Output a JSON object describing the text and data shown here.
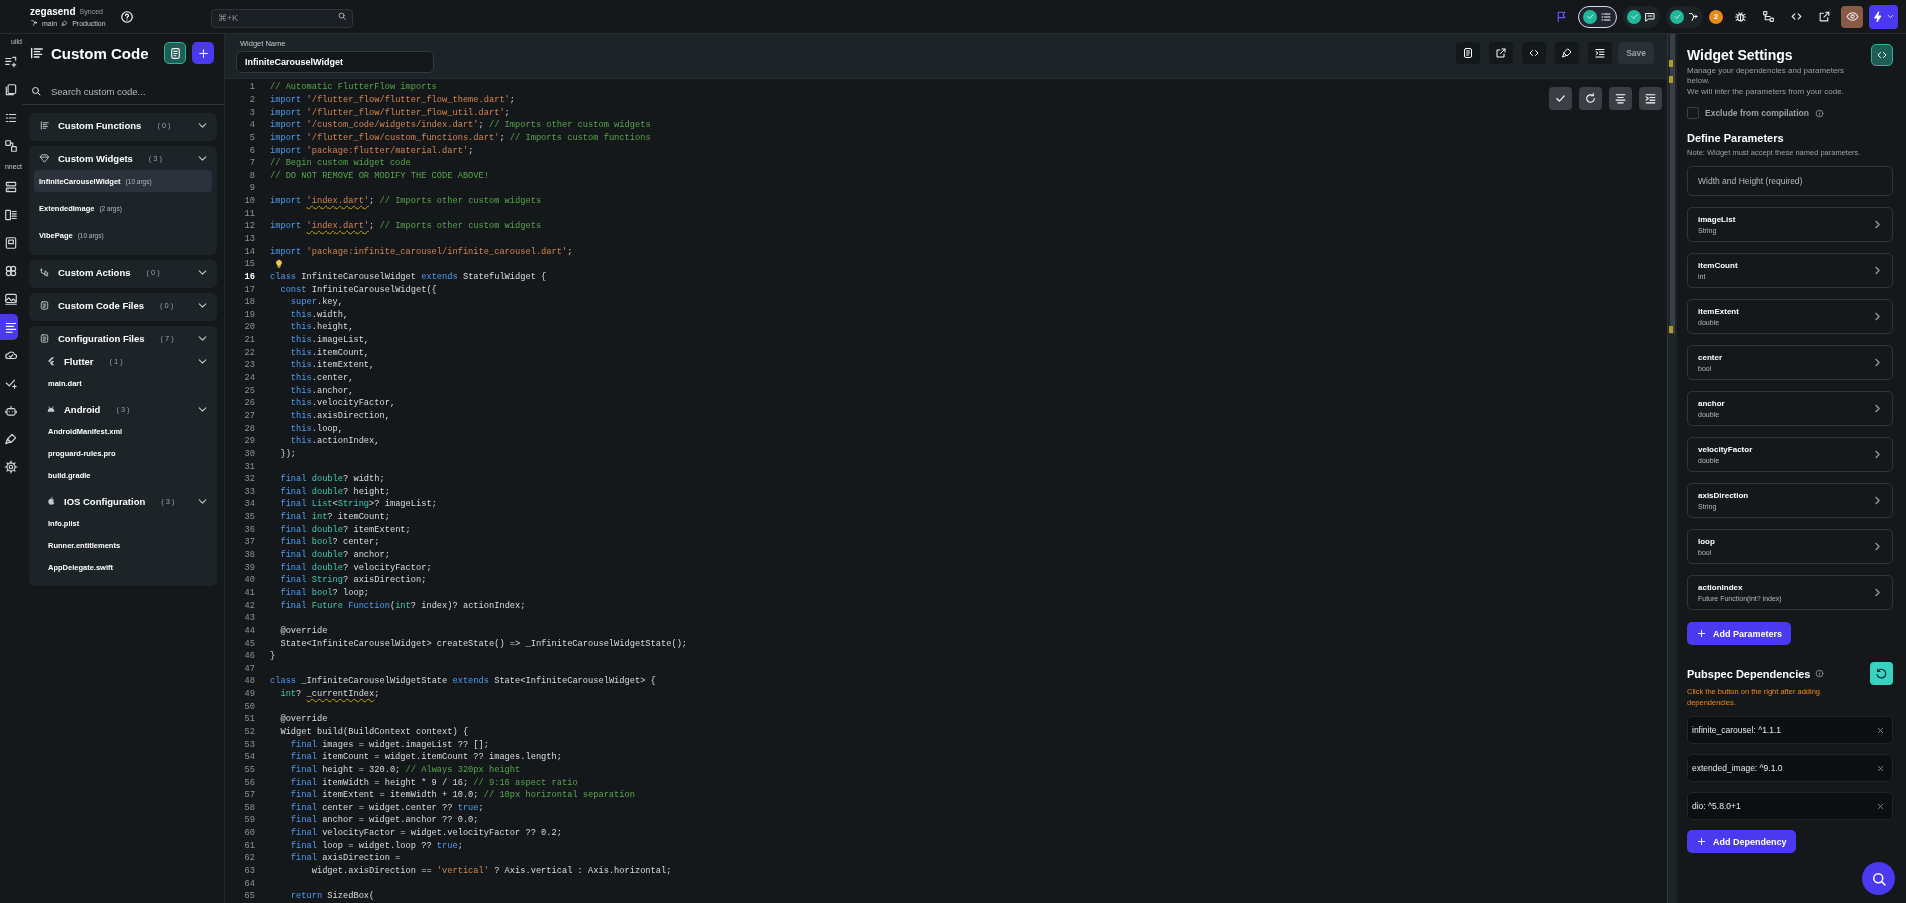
{
  "top_bar": {
    "project": "zegasend",
    "sync_status": "Synced",
    "branch": "main",
    "environment": "Production",
    "search": {
      "placeholder": "⌘+K"
    },
    "badge_count": "2",
    "preview_selected": true
  },
  "rail": {
    "groups": [
      {
        "label": "uild",
        "items": [
          {
            "selected": false
          },
          {
            "selected": false
          },
          {
            "selected": false
          },
          {
            "selected": false
          }
        ]
      },
      {
        "label": "nnect",
        "items": [
          {
            "selected": false
          },
          {
            "selected": false
          },
          {
            "selected": false
          },
          {
            "selected": false
          },
          {
            "selected": false
          },
          {
            "selected": true
          },
          {
            "selected": false
          },
          {
            "selected": false
          },
          {
            "selected": false
          },
          {
            "selected": false
          },
          {
            "selected": false
          }
        ]
      }
    ]
  },
  "sidebar": {
    "title": "Custom Code",
    "search": {
      "placeholder": "Search custom code..."
    },
    "sections": [
      {
        "title": "Custom Functions",
        "count": "(0)"
      },
      {
        "title": "Custom Widgets",
        "count": "(3)",
        "items": [
          {
            "name": "InfiniteCarouselWidget",
            "args": "(10 args)",
            "selected": true
          },
          {
            "name": "ExtendedImage",
            "args": "(2 args)",
            "selected": false
          },
          {
            "name": "VibePage",
            "args": "(10 args)",
            "selected": false
          }
        ]
      },
      {
        "title": "Custom Actions",
        "count": "(0)"
      },
      {
        "title": "Custom Code Files",
        "count": "(0)"
      },
      {
        "title": "Configuration Files",
        "count": "(7)",
        "groups": [
          {
            "title": "Flutter",
            "count": "(1)",
            "files": [
              "main.dart"
            ]
          },
          {
            "title": "Android",
            "count": "(3)",
            "files": [
              "AndroidManifest.xml",
              "proguard-rules.pro",
              "build.gradle"
            ]
          },
          {
            "title": "IOS Configuration",
            "count": "(3)",
            "files": [
              "Info.plist",
              "Runner.entitlements",
              "AppDelegate.swift"
            ]
          }
        ]
      }
    ]
  },
  "editor": {
    "widget_name": {
      "label": "Widget Name",
      "value": "InfiniteCarouselWidget"
    },
    "save_label": "Save",
    "lines": [
      {
        "number": "1",
        "current": false,
        "kind": "code",
        "tokens": [
          {
            "kind": "cmt",
            "text": "// Automatic FlutterFlow imports"
          }
        ]
      },
      {
        "number": "2",
        "current": false,
        "kind": "code",
        "tokens": [
          {
            "kind": "kw",
            "text": "import "
          },
          {
            "kind": "str",
            "text": "'/flutter_flow/flutter_flow_theme.dart'"
          },
          {
            "kind": "plain",
            "text": ";"
          }
        ]
      },
      {
        "number": "3",
        "current": false,
        "kind": "code",
        "tokens": [
          {
            "kind": "kw",
            "text": "import "
          },
          {
            "kind": "str",
            "text": "'/flutter_flow/flutter_flow_util.dart'"
          },
          {
            "kind": "plain",
            "text": ";"
          }
        ]
      },
      {
        "number": "4",
        "current": false,
        "kind": "code",
        "tokens": [
          {
            "kind": "kw",
            "text": "import "
          },
          {
            "kind": "str",
            "text": "'/custom_code/widgets/index.dart'"
          },
          {
            "kind": "plain",
            "text": "; "
          },
          {
            "kind": "cmt",
            "text": "// Imports other custom widgets"
          }
        ]
      },
      {
        "number": "5",
        "current": false,
        "kind": "code",
        "tokens": [
          {
            "kind": "kw",
            "text": "import "
          },
          {
            "kind": "str",
            "text": "'/flutter_flow/custom_functions.dart'"
          },
          {
            "kind": "plain",
            "text": "; "
          },
          {
            "kind": "cmt",
            "text": "// Imports custom functions"
          }
        ]
      },
      {
        "number": "6",
        "current": false,
        "kind": "code",
        "tokens": [
          {
            "kind": "kw",
            "text": "import "
          },
          {
            "kind": "str",
            "text": "'package:flutter/material.dart'"
          },
          {
            "kind": "plain",
            "text": ";"
          }
        ]
      },
      {
        "number": "7",
        "current": false,
        "kind": "code",
        "tokens": [
          {
            "kind": "cmt",
            "text": "// Begin custom widget code"
          }
        ]
      },
      {
        "number": "8",
        "current": false,
        "kind": "code",
        "tokens": [
          {
            "kind": "cmt",
            "text": "// DO NOT REMOVE OR MODIFY THE CODE ABOVE!"
          }
        ]
      },
      {
        "number": "9",
        "current": false,
        "kind": "code"
      },
      {
        "number": "10",
        "current": false,
        "kind": "code",
        "tokens": [
          {
            "kind": "kw",
            "text": "import "
          },
          {
            "kind": "warn_str",
            "text": "'index.dart'"
          },
          {
            "kind": "plain",
            "text": "; "
          },
          {
            "kind": "cmt",
            "text": "// Imports other custom widgets"
          }
        ]
      },
      {
        "number": "11",
        "current": false,
        "kind": "code"
      },
      {
        "number": "12",
        "current": false,
        "kind": "code",
        "tokens": [
          {
            "kind": "kw",
            "text": "import "
          },
          {
            "kind": "warn_str",
            "text": "'index.dart'"
          },
          {
            "kind": "plain",
            "text": "; "
          },
          {
            "kind": "cmt",
            "text": "// Imports other custom widgets"
          }
        ]
      },
      {
        "number": "13",
        "current": false,
        "kind": "code"
      },
      {
        "number": "14",
        "current": false,
        "kind": "code",
        "tokens": [
          {
            "kind": "kw",
            "text": "import "
          },
          {
            "kind": "str",
            "text": "'package:infinite_carousel/infinite_carousel.dart'"
          },
          {
            "kind": "plain",
            "text": ";"
          }
        ]
      },
      {
        "number": "15",
        "current": false,
        "kind": "hint"
      },
      {
        "number": "16",
        "current": true,
        "kind": "code",
        "tokens": [
          {
            "kind": "kw",
            "text": "class"
          },
          {
            "kind": "plain",
            "text": " InfiniteCarouselWidget "
          },
          {
            "kind": "kw",
            "text": "extends"
          },
          {
            "kind": "plain",
            "text": " StatefulWidget {"
          }
        ]
      },
      {
        "number": "17",
        "current": false,
        "kind": "code",
        "tokens": [
          {
            "kind": "kw",
            "text": "  const"
          },
          {
            "kind": "plain",
            "text": " InfiniteCarouselWidget({"
          }
        ]
      },
      {
        "number": "18",
        "current": false,
        "kind": "code",
        "tokens": [
          {
            "kind": "kw",
            "text": "    super"
          },
          {
            "kind": "plain",
            "text": ".key,"
          }
        ]
      },
      {
        "number": "19",
        "current": false,
        "kind": "code",
        "tokens": [
          {
            "kind": "kw",
            "text": "    this"
          },
          {
            "kind": "plain",
            "text": ".width,"
          }
        ]
      },
      {
        "number": "20",
        "current": false,
        "kind": "code",
        "tokens": [
          {
            "kind": "kw",
            "text": "    this"
          },
          {
            "kind": "plain",
            "text": ".height,"
          }
        ]
      },
      {
        "number": "21",
        "current": false,
        "kind": "code",
        "tokens": [
          {
            "kind": "kw",
            "text": "    this"
          },
          {
            "kind": "plain",
            "text": ".imageList,"
          }
        ]
      },
      {
        "number": "22",
        "current": false,
        "kind": "code",
        "tokens": [
          {
            "kind": "kw",
            "text": "    this"
          },
          {
            "kind": "plain",
            "text": ".itemCount,"
          }
        ]
      },
      {
        "number": "23",
        "current": false,
        "kind": "code",
        "tokens": [
          {
            "kind": "kw",
            "text": "    this"
          },
          {
            "kind": "plain",
            "text": ".itemExtent,"
          }
        ]
      },
      {
        "number": "24",
        "current": false,
        "kind": "code",
        "tokens": [
          {
            "kind": "kw",
            "text": "    this"
          },
          {
            "kind": "plain",
            "text": ".center,"
          }
        ]
      },
      {
        "number": "25",
        "current": false,
        "kind": "code",
        "tokens": [
          {
            "kind": "kw",
            "text": "    this"
          },
          {
            "kind": "plain",
            "text": ".anchor,"
          }
        ]
      },
      {
        "number": "26",
        "current": false,
        "kind": "code",
        "tokens": [
          {
            "kind": "kw",
            "text": "    this"
          },
          {
            "kind": "plain",
            "text": ".velocityFactor,"
          }
        ]
      },
      {
        "number": "27",
        "current": false,
        "kind": "code",
        "tokens": [
          {
            "kind": "kw",
            "text": "    this"
          },
          {
            "kind": "plain",
            "text": ".axisDirection,"
          }
        ]
      },
      {
        "number": "28",
        "current": false,
        "kind": "code",
        "tokens": [
          {
            "kind": "kw",
            "text": "    this"
          },
          {
            "kind": "plain",
            "text": ".loop,"
          }
        ]
      },
      {
        "number": "29",
        "current": false,
        "kind": "code",
        "tokens": [
          {
            "kind": "kw",
            "text": "    this"
          },
          {
            "kind": "plain",
            "text": ".actionIndex,"
          }
        ]
      },
      {
        "number": "30",
        "current": false,
        "kind": "code",
        "tokens": [
          {
            "kind": "plain",
            "text": "  });"
          }
        ]
      },
      {
        "number": "31",
        "current": false,
        "kind": "code"
      },
      {
        "number": "32",
        "current": false,
        "kind": "code",
        "tokens": [
          {
            "kind": "kw",
            "text": "  final "
          },
          {
            "kind": "type",
            "text": "double"
          },
          {
            "kind": "plain",
            "text": "? width;"
          }
        ]
      },
      {
        "number": "33",
        "current": false,
        "kind": "code",
        "tokens": [
          {
            "kind": "kw",
            "text": "  final "
          },
          {
            "kind": "type",
            "text": "double"
          },
          {
            "kind": "plain",
            "text": "? height;"
          }
        ]
      },
      {
        "number": "34",
        "current": false,
        "kind": "code",
        "tokens": [
          {
            "kind": "kw",
            "text": "  final "
          },
          {
            "kind": "type",
            "text": "List"
          },
          {
            "kind": "plain",
            "text": "<"
          },
          {
            "kind": "type",
            "text": "String"
          },
          {
            "kind": "plain",
            "text": ">? imageList;"
          }
        ]
      },
      {
        "number": "35",
        "current": false,
        "kind": "code",
        "tokens": [
          {
            "kind": "kw",
            "text": "  final "
          },
          {
            "kind": "type",
            "text": "int"
          },
          {
            "kind": "plain",
            "text": "? itemCount;"
          }
        ]
      },
      {
        "number": "36",
        "current": false,
        "kind": "code",
        "tokens": [
          {
            "kind": "kw",
            "text": "  final "
          },
          {
            "kind": "type",
            "text": "double"
          },
          {
            "kind": "plain",
            "text": "? itemExtent;"
          }
        ]
      },
      {
        "number": "37",
        "current": false,
        "kind": "code",
        "tokens": [
          {
            "kind": "kw",
            "text": "  final "
          },
          {
            "kind": "type",
            "text": "bool"
          },
          {
            "kind": "plain",
            "text": "? center;"
          }
        ]
      },
      {
        "number": "38",
        "current": false,
        "kind": "code",
        "tokens": [
          {
            "kind": "kw",
            "text": "  final "
          },
          {
            "kind": "type",
            "text": "double"
          },
          {
            "kind": "plain",
            "text": "? anchor;"
          }
        ]
      },
      {
        "number": "39",
        "current": false,
        "kind": "code",
        "tokens": [
          {
            "kind": "kw",
            "text": "  final "
          },
          {
            "kind": "type",
            "text": "double"
          },
          {
            "kind": "plain",
            "text": "? velocityFactor;"
          }
        ]
      },
      {
        "number": "40",
        "current": false,
        "kind": "code",
        "tokens": [
          {
            "kind": "kw",
            "text": "  final "
          },
          {
            "kind": "type",
            "text": "String"
          },
          {
            "kind": "plain",
            "text": "? axisDirection;"
          }
        ]
      },
      {
        "number": "41",
        "current": false,
        "kind": "code",
        "tokens": [
          {
            "kind": "kw",
            "text": "  final "
          },
          {
            "kind": "type",
            "text": "bool"
          },
          {
            "kind": "plain",
            "text": "? loop;"
          }
        ]
      },
      {
        "number": "42",
        "current": false,
        "kind": "code",
        "tokens": [
          {
            "kind": "kw",
            "text": "  final "
          },
          {
            "kind": "type",
            "text": "Future "
          },
          {
            "kind": "kw",
            "text": "Function"
          },
          {
            "kind": "plain",
            "text": "("
          },
          {
            "kind": "type",
            "text": "int"
          },
          {
            "kind": "plain",
            "text": "? index)? actionIndex;"
          }
        ]
      },
      {
        "number": "43",
        "current": false,
        "kind": "code"
      },
      {
        "number": "44",
        "current": false,
        "kind": "code",
        "tokens": [
          {
            "kind": "plain",
            "text": "  @override"
          }
        ]
      },
      {
        "number": "45",
        "current": false,
        "kind": "code",
        "tokens": [
          {
            "kind": "plain",
            "text": "  State<InfiniteCarouselWidget> createState() => _InfiniteCarouselWidgetState();"
          }
        ]
      },
      {
        "number": "46",
        "current": false,
        "kind": "code",
        "tokens": [
          {
            "kind": "plain",
            "text": "}"
          }
        ]
      },
      {
        "number": "47",
        "current": false,
        "kind": "code"
      },
      {
        "number": "48",
        "current": false,
        "kind": "code",
        "tokens": [
          {
            "kind": "kw",
            "text": "class"
          },
          {
            "kind": "plain",
            "text": " _InfiniteCarouselWidgetState "
          },
          {
            "kind": "kw",
            "text": "extends"
          },
          {
            "kind": "plain",
            "text": " State<InfiniteCarouselWidget> {"
          }
        ]
      },
      {
        "number": "49",
        "current": false,
        "kind": "code",
        "tokens": [
          {
            "kind": "type",
            "text": "  int"
          },
          {
            "kind": "plain",
            "text": "? "
          },
          {
            "kind": "warn_plain",
            "text": "_currentIndex"
          },
          {
            "kind": "plain",
            "text": ";"
          }
        ]
      },
      {
        "number": "50",
        "current": false,
        "kind": "code"
      },
      {
        "number": "51",
        "current": false,
        "kind": "code",
        "tokens": [
          {
            "kind": "plain",
            "text": "  @override"
          }
        ]
      },
      {
        "number": "52",
        "current": false,
        "kind": "code",
        "tokens": [
          {
            "kind": "plain",
            "text": "  Widget build(BuildContext context) {"
          }
        ]
      },
      {
        "number": "53",
        "current": false,
        "kind": "code",
        "tokens": [
          {
            "kind": "kw",
            "text": "    final"
          },
          {
            "kind": "plain",
            "text": " images = widget.imageList ?? [];"
          }
        ]
      },
      {
        "number": "54",
        "current": false,
        "kind": "code",
        "tokens": [
          {
            "kind": "kw",
            "text": "    final"
          },
          {
            "kind": "plain",
            "text": " itemCount = widget.itemCount ?? images.length;"
          }
        ]
      },
      {
        "number": "55",
        "current": false,
        "kind": "code",
        "tokens": [
          {
            "kind": "kw",
            "text": "    final"
          },
          {
            "kind": "plain",
            "text": " height = 320.0; "
          },
          {
            "kind": "cmt",
            "text": "// Always 320px height"
          }
        ]
      },
      {
        "number": "56",
        "current": false,
        "kind": "code",
        "tokens": [
          {
            "kind": "kw",
            "text": "    final"
          },
          {
            "kind": "plain",
            "text": " itemWidth = height * 9 / 16; "
          },
          {
            "kind": "cmt",
            "text": "// 9:16 aspect ratio"
          }
        ]
      },
      {
        "number": "57",
        "current": false,
        "kind": "code",
        "tokens": [
          {
            "kind": "kw",
            "text": "    final"
          },
          {
            "kind": "plain",
            "text": " itemExtent = itemWidth + 10.0; "
          },
          {
            "kind": "cmt",
            "text": "// 10px horizontal separation"
          }
        ]
      },
      {
        "number": "58",
        "current": false,
        "kind": "code",
        "tokens": [
          {
            "kind": "kw",
            "text": "    final"
          },
          {
            "kind": "plain",
            "text": " center = widget.center ?? "
          },
          {
            "kind": "kw",
            "text": "true"
          },
          {
            "kind": "plain",
            "text": ";"
          }
        ]
      },
      {
        "number": "59",
        "current": false,
        "kind": "code",
        "tokens": [
          {
            "kind": "kw",
            "text": "    final"
          },
          {
            "kind": "plain",
            "text": " anchor = widget.anchor ?? 0.0;"
          }
        ]
      },
      {
        "number": "60",
        "current": false,
        "kind": "code",
        "tokens": [
          {
            "kind": "kw",
            "text": "    final"
          },
          {
            "kind": "plain",
            "text": " velocityFactor = widget.velocityFactor ?? 0.2;"
          }
        ]
      },
      {
        "number": "61",
        "current": false,
        "kind": "code",
        "tokens": [
          {
            "kind": "kw",
            "text": "    final"
          },
          {
            "kind": "plain",
            "text": " loop = widget.loop ?? "
          },
          {
            "kind": "kw",
            "text": "true"
          },
          {
            "kind": "plain",
            "text": ";"
          }
        ]
      },
      {
        "number": "62",
        "current": false,
        "kind": "code",
        "tokens": [
          {
            "kind": "kw",
            "text": "    final"
          },
          {
            "kind": "plain",
            "text": " axisDirection ="
          }
        ]
      },
      {
        "number": "63",
        "current": false,
        "kind": "code",
        "tokens": [
          {
            "kind": "plain",
            "text": "        widget.axisDirection == "
          },
          {
            "kind": "str",
            "text": "'vertical'"
          },
          {
            "kind": "plain",
            "text": " ? Axis.vertical : Axis.horizontal;"
          }
        ]
      },
      {
        "number": "64",
        "current": false,
        "kind": "code"
      },
      {
        "number": "65",
        "current": false,
        "kind": "code",
        "tokens": [
          {
            "kind": "kw",
            "text": "    return"
          },
          {
            "kind": "plain",
            "text": " SizedBox("
          }
        ]
      }
    ]
  },
  "settings": {
    "title": "Widget Settings",
    "description": [
      "Manage your dependencies and parameters below.",
      "We will infer the parameters from your code."
    ],
    "exclude": {
      "label": "Exclude from compilation",
      "checked": false
    },
    "define_title": "Define Parameters",
    "define_note": "Note: Widget must accept these named parameters.",
    "fixed_parameter": "Width and Height (required)",
    "parameters": [
      {
        "name": "imageList",
        "type": "String"
      },
      {
        "name": "itemCount",
        "type": "int"
      },
      {
        "name": "itemExtent",
        "type": "double"
      },
      {
        "name": "center",
        "type": "bool"
      },
      {
        "name": "anchor",
        "type": "double"
      },
      {
        "name": "velocityFactor",
        "type": "double"
      },
      {
        "name": "axisDirection",
        "type": "String"
      },
      {
        "name": "loop",
        "type": "bool"
      },
      {
        "name": "actionIndex",
        "type": "Future Function(int? index)"
      }
    ],
    "add_parameters": "Add Parameters",
    "pubspec_title": "Pubspec Dependencies",
    "pubspec_warning": "Click the button on the right after adding dependencies.",
    "dependencies": [
      "infinite_carousel: ^1.1.1",
      "extended_image: ^9.1.0",
      "dio: ^5.8.0+1"
    ],
    "add_dependency": "Add Dependency"
  }
}
